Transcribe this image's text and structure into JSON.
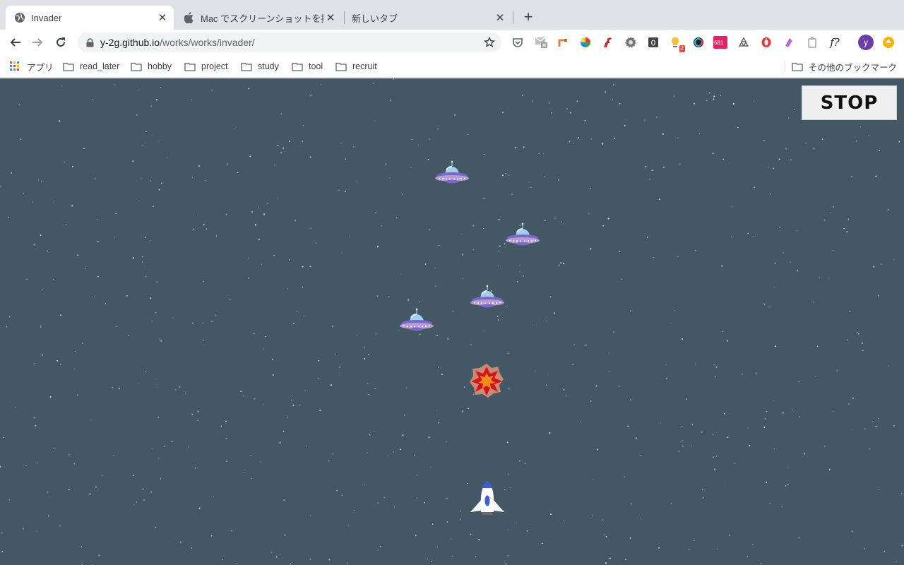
{
  "browser": {
    "tabs": [
      {
        "title": "Invader",
        "active": true,
        "icon": "globe-icon"
      },
      {
        "title": "Mac でスクリーンショットを撮る",
        "active": false,
        "icon": "apple-icon"
      },
      {
        "title": "新しいタブ",
        "active": false,
        "icon": ""
      }
    ],
    "address": {
      "host": "y-2g.github.io",
      "path": "/works/works/invader/"
    },
    "badges": {
      "lightbulb": "2",
      "counter": "681"
    },
    "avatar_letter": "y",
    "bookmarks": [
      {
        "label": "アプリ",
        "icon": "apps-grid-icon"
      },
      {
        "label": "read_later",
        "icon": "folder-icon"
      },
      {
        "label": "hobby",
        "icon": "folder-icon"
      },
      {
        "label": "project",
        "icon": "folder-icon"
      },
      {
        "label": "study",
        "icon": "folder-icon"
      },
      {
        "label": "tool",
        "icon": "folder-icon"
      },
      {
        "label": "recruit",
        "icon": "folder-icon"
      }
    ],
    "other_bookmarks": "その他のブックマーク"
  },
  "game": {
    "stop_label": "STOP",
    "background_color": "#435765",
    "entities": [
      "ufo",
      "ufo",
      "ufo",
      "ufo",
      "explosion",
      "rocket"
    ]
  }
}
